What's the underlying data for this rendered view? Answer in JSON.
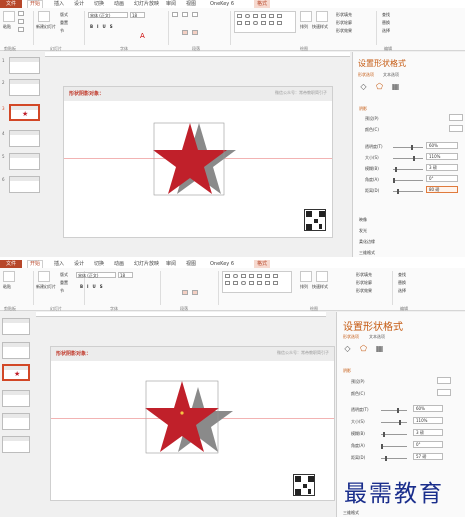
{
  "ribbon": {
    "tabs": [
      "文件",
      "开始",
      "插入",
      "设计",
      "切换",
      "动画",
      "幻灯片放映",
      "审阅",
      "视图",
      "OneKey 6",
      "格式"
    ],
    "active_tab": "开始",
    "context_tab": "格式",
    "groups": [
      "剪贴板",
      "幻灯片",
      "字体",
      "段落",
      "绘图",
      "编辑"
    ],
    "paste": "粘贴",
    "new_slide": "新建幻灯片",
    "layout": "版式",
    "reset": "重置",
    "section": "节",
    "font_name": "宋体 (正文)",
    "font_size": "18",
    "arrange": "排列",
    "quick_styles": "快速样式",
    "shape_fill": "形状填充",
    "shape_outline": "形状轮廓",
    "shape_effects": "形状效果",
    "find": "查找",
    "replace": "替换",
    "select": "选择"
  },
  "thumbnails": [
    "1",
    "2",
    "3",
    "4",
    "5",
    "6"
  ],
  "slide": {
    "title": "形状阴影对象：",
    "right_text": "微信公众号：常帝教职简引子"
  },
  "pane": {
    "title": "设置形状格式",
    "sub_tabs": [
      "形状选项",
      "文本选项"
    ],
    "section": "阴影",
    "rows": [
      "预设(P)",
      "颜色(C)",
      "透明度(T)",
      "大小(S)",
      "模糊(B)",
      "角度(A)",
      "距离(D)"
    ],
    "values_1": [
      "60%",
      "110%",
      "3 磅",
      "0°",
      "80 磅"
    ],
    "values_2": [
      "60%",
      "110%",
      "3 磅",
      "0°",
      "57 磅"
    ],
    "extra_sections": [
      "映像",
      "发光",
      "柔化边缘",
      "三维格式"
    ]
  },
  "watermark": "最需教育",
  "colors": {
    "accent": "#d24726",
    "star": "#c0202a",
    "shadow": "#8a8a8a"
  }
}
